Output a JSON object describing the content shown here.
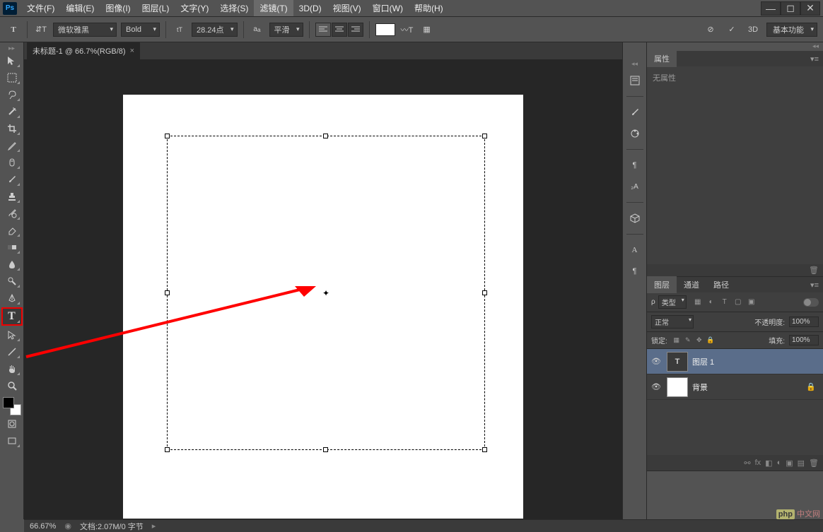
{
  "app": {
    "icon_text": "Ps"
  },
  "menu": {
    "file": "文件(F)",
    "edit": "编辑(E)",
    "image": "图像(I)",
    "layer": "图层(L)",
    "type": "文字(Y)",
    "select": "选择(S)",
    "filter": "滤镜(T)",
    "threeD": "3D(D)",
    "view": "视图(V)",
    "window": "窗口(W)",
    "help": "帮助(H)"
  },
  "options": {
    "font_family": "微软雅黑",
    "font_weight": "Bold",
    "font_size": "28.24点",
    "antialiasing": "平滑",
    "threeD_label": "3D",
    "workspace": "基本功能"
  },
  "document": {
    "tab_title": "未标题-1 @ 66.7%(RGB/8)"
  },
  "panels": {
    "properties": {
      "tab": "属性",
      "empty_text": "无属性"
    },
    "layers": {
      "tab_layers": "图层",
      "tab_channels": "通道",
      "tab_paths": "路径",
      "filter_label": "类型",
      "blend_mode": "正常",
      "opacity_label": "不透明度:",
      "opacity_value": "100%",
      "lock_label": "锁定:",
      "fill_label": "填充:",
      "fill_value": "100%",
      "items": [
        {
          "name": "图层 1",
          "type": "text",
          "thumb_text": "T",
          "visible": true,
          "selected": true
        },
        {
          "name": "背景",
          "type": "image",
          "visible": true,
          "locked": true
        }
      ]
    }
  },
  "status": {
    "zoom": "66.67%",
    "doc_info": "文档:2.07M/0 字节"
  },
  "watermark": "php 中文网",
  "icons": {
    "type_tool": "T",
    "eye": "👁",
    "lock": "🔒",
    "trash": "🗑",
    "search": "🔍",
    "gear": "⚙"
  }
}
